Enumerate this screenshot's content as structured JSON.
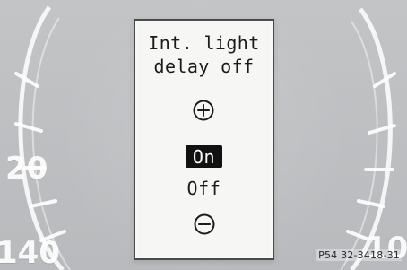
{
  "display": {
    "title": "Int. light\ndelay off",
    "icons": {
      "increase": "plus-circle-icon",
      "decrease": "minus-circle-icon"
    },
    "options": [
      {
        "label": "On",
        "selected": true
      },
      {
        "label": "Off",
        "selected": false
      }
    ]
  },
  "cluster": {
    "left_labels": [
      "20",
      "140"
    ],
    "right_label": "10"
  },
  "image_credit": "P54 32-3418-31",
  "colors": {
    "background": "#bfc1c3",
    "display_bg": "#f6f6f4",
    "display_border": "#4a4a4a",
    "selected_bg": "#111111",
    "selected_text": "#ffffff",
    "text": "#1b1b1b"
  }
}
